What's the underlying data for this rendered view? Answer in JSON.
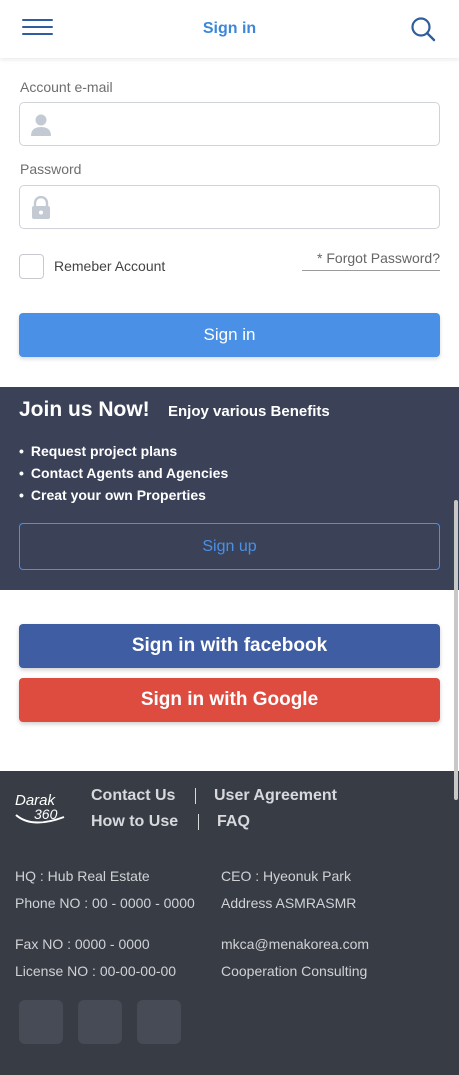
{
  "header": {
    "title": "Sign in",
    "menu_icon": "hamburger-icon",
    "search_icon": "search-icon"
  },
  "form": {
    "email_label": "Account e-mail",
    "email_value": "",
    "password_label": "Password",
    "password_value": "",
    "remember_label": "Remeber Account",
    "remember_checked": false,
    "forgot_label": "* Forgot Password?",
    "signin_label": "Sign in"
  },
  "join": {
    "title": "Join us Now!",
    "subtitle": "Enjoy various Benefits",
    "benefits": [
      "Request project plans",
      "Contact Agents and Agencies",
      "Creat your own Properties"
    ],
    "signup_label": "Sign up"
  },
  "social_login": {
    "facebook_label": "Sign in with facebook",
    "google_label": "Sign in with Google"
  },
  "footer": {
    "logo_text_top": "Darak",
    "logo_text_bottom": "360",
    "links": [
      "Contact Us",
      "User Agreement",
      "How to Use",
      "FAQ"
    ],
    "info_left": [
      "HQ : Hub Real Estate",
      "Phone NO : 00 - 0000 - 0000",
      "Fax NO : 0000 - 0000",
      "License NO : 00-00-00-00"
    ],
    "info_right": [
      "CEO : Hyeonuk Park",
      "Address ASMRASMR",
      "mkca@menakorea.com",
      "Cooperation Consulting"
    ]
  },
  "colors": {
    "primary": "#4a90e6",
    "facebook": "#3f5da3",
    "google": "#de4c40",
    "join_bg": "#3b4257",
    "footer_bg": "#383c45"
  }
}
